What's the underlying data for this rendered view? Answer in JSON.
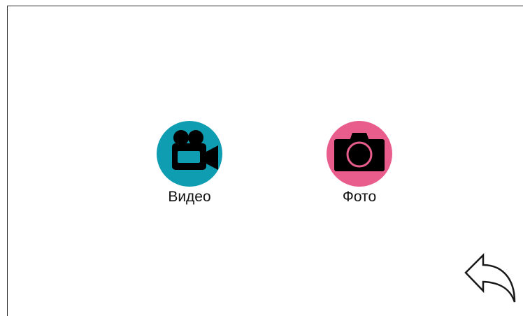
{
  "menu": {
    "items": [
      {
        "label": "Видео",
        "icon": "video-camera-icon",
        "color": "#0f9db1"
      },
      {
        "label": "Фото",
        "icon": "photo-camera-icon",
        "color": "#e85d8c"
      }
    ]
  },
  "navigation": {
    "back_icon": "back-arrow-icon"
  },
  "colors": {
    "background": "#ffffff",
    "icon_fill": "#000000",
    "video_accent": "#0f9db1",
    "photo_accent": "#e85d8c"
  }
}
